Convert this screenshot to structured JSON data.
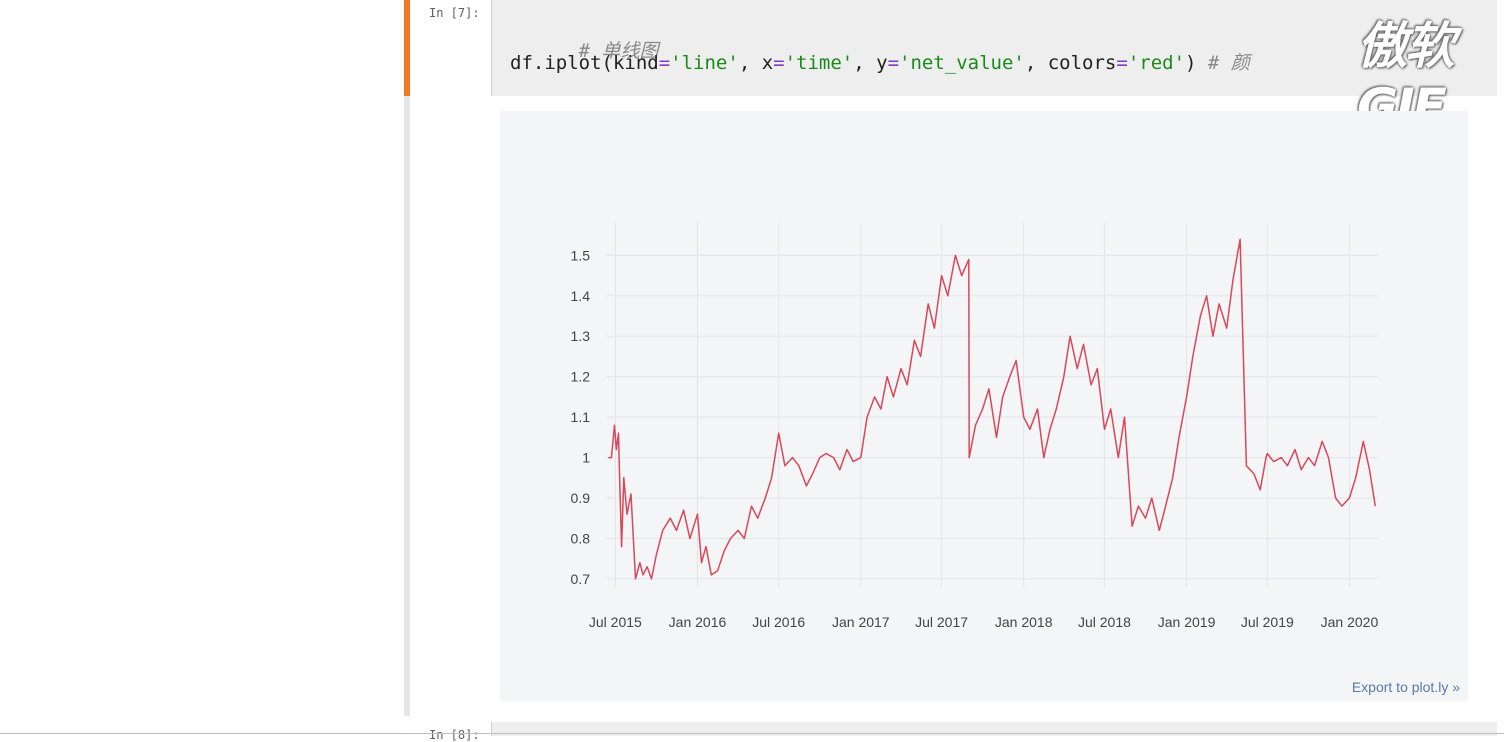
{
  "cell7": {
    "prompt": "In [7]:",
    "code": {
      "comment1": "# 单线图",
      "line2_parts": [
        "df.iplot(kind",
        "=",
        "'line'",
        ", x",
        "=",
        "'time'",
        ", y",
        "=",
        "'net_value'",
        ", colors",
        "=",
        "'red'",
        ") ",
        "# 颜"
      ]
    },
    "watermark": "傲软GIF",
    "export_link": "Export to plot.ly »"
  },
  "cell8": {
    "prompt": "In [8]:"
  },
  "colors": {
    "line": "#d9485a",
    "accent": "#f37726",
    "grid": "#e1e4ea",
    "plot_bg": "#f4f5f7"
  },
  "chart_data": {
    "type": "line",
    "x": [
      "2015-06-15",
      "2015-06-22",
      "2015-06-29",
      "2015-07-03",
      "2015-07-08",
      "2015-07-10",
      "2015-07-15",
      "2015-07-20",
      "2015-07-27",
      "2015-08-05",
      "2015-08-15",
      "2015-08-25",
      "2015-09-01",
      "2015-09-10",
      "2015-09-20",
      "2015-10-01",
      "2015-10-15",
      "2015-11-01",
      "2015-11-15",
      "2015-12-01",
      "2015-12-15",
      "2016-01-01",
      "2016-01-10",
      "2016-01-20",
      "2016-02-01",
      "2016-02-15",
      "2016-03-01",
      "2016-03-15",
      "2016-04-01",
      "2016-04-15",
      "2016-05-01",
      "2016-05-15",
      "2016-06-01",
      "2016-06-15",
      "2016-07-01",
      "2016-07-15",
      "2016-08-01",
      "2016-08-15",
      "2016-09-01",
      "2016-09-15",
      "2016-10-01",
      "2016-10-15",
      "2016-11-01",
      "2016-11-15",
      "2016-12-01",
      "2016-12-15",
      "2017-01-01",
      "2017-01-15",
      "2017-02-01",
      "2017-02-15",
      "2017-03-01",
      "2017-03-15",
      "2017-04-01",
      "2017-04-15",
      "2017-05-01",
      "2017-05-15",
      "2017-06-01",
      "2017-06-15",
      "2017-07-01",
      "2017-07-15",
      "2017-08-01",
      "2017-08-15",
      "2017-08-31",
      "2017-09-01",
      "2017-09-15",
      "2017-10-01",
      "2017-10-15",
      "2017-11-01",
      "2017-11-15",
      "2017-12-01",
      "2017-12-15",
      "2018-01-01",
      "2018-01-15",
      "2018-02-01",
      "2018-02-15",
      "2018-03-01",
      "2018-03-15",
      "2018-04-01",
      "2018-04-15",
      "2018-05-01",
      "2018-05-15",
      "2018-06-01",
      "2018-06-15",
      "2018-07-01",
      "2018-07-15",
      "2018-08-01",
      "2018-08-15",
      "2018-09-01",
      "2018-09-15",
      "2018-10-01",
      "2018-10-15",
      "2018-11-01",
      "2018-11-15",
      "2018-12-01",
      "2018-12-15",
      "2019-01-01",
      "2019-01-15",
      "2019-02-01",
      "2019-02-15",
      "2019-03-01",
      "2019-03-15",
      "2019-04-01",
      "2019-04-15",
      "2019-05-01",
      "2019-05-15",
      "2019-06-01",
      "2019-06-15",
      "2019-06-28",
      "2019-07-01",
      "2019-07-15",
      "2019-08-01",
      "2019-08-15",
      "2019-09-01",
      "2019-09-15",
      "2019-10-01",
      "2019-10-15",
      "2019-11-01",
      "2019-11-15",
      "2019-12-01",
      "2019-12-15",
      "2020-01-01",
      "2020-01-15",
      "2020-02-01",
      "2020-02-15",
      "2020-02-28"
    ],
    "y": [
      1.0,
      1.0,
      1.08,
      1.02,
      1.06,
      0.97,
      0.78,
      0.95,
      0.86,
      0.91,
      0.7,
      0.74,
      0.71,
      0.73,
      0.7,
      0.76,
      0.82,
      0.85,
      0.82,
      0.87,
      0.8,
      0.86,
      0.74,
      0.78,
      0.71,
      0.72,
      0.77,
      0.8,
      0.82,
      0.8,
      0.88,
      0.85,
      0.9,
      0.95,
      1.06,
      0.98,
      1.0,
      0.98,
      0.93,
      0.96,
      1.0,
      1.01,
      1.0,
      0.97,
      1.02,
      0.99,
      1.0,
      1.1,
      1.15,
      1.12,
      1.2,
      1.15,
      1.22,
      1.18,
      1.29,
      1.25,
      1.38,
      1.32,
      1.45,
      1.4,
      1.5,
      1.45,
      1.49,
      1.0,
      1.08,
      1.12,
      1.17,
      1.05,
      1.15,
      1.2,
      1.24,
      1.1,
      1.07,
      1.12,
      1.0,
      1.07,
      1.12,
      1.2,
      1.3,
      1.22,
      1.28,
      1.18,
      1.22,
      1.07,
      1.12,
      1.0,
      1.1,
      0.83,
      0.88,
      0.85,
      0.9,
      0.82,
      0.88,
      0.95,
      1.05,
      1.15,
      1.25,
      1.35,
      1.4,
      1.3,
      1.38,
      1.32,
      1.44,
      1.54,
      0.98,
      0.96,
      0.92,
      1.0,
      1.01,
      0.99,
      1.0,
      0.98,
      1.02,
      0.97,
      1.0,
      0.98,
      1.04,
      1.0,
      0.9,
      0.88,
      0.9,
      0.95,
      1.04,
      0.97,
      0.88
    ],
    "ylim": [
      0.68,
      1.58
    ],
    "yticks": [
      0.7,
      0.8,
      0.9,
      1,
      1.1,
      1.2,
      1.3,
      1.4,
      1.5
    ],
    "ytick_labels": [
      "0.7",
      "0.8",
      "0.9",
      "1",
      "1.1",
      "1.2",
      "1.3",
      "1.4",
      "1.5"
    ],
    "xticks": [
      "2015-07-01",
      "2016-01-01",
      "2016-07-01",
      "2017-01-01",
      "2017-07-01",
      "2018-01-01",
      "2018-07-01",
      "2019-01-01",
      "2019-07-01",
      "2020-01-01"
    ],
    "xtick_labels": [
      "Jul 2015",
      "Jan 2016",
      "Jul 2016",
      "Jan 2017",
      "Jul 2017",
      "Jan 2018",
      "Jul 2018",
      "Jan 2019",
      "Jul 2019",
      "Jan 2020"
    ],
    "xlim": [
      "2015-06-10",
      "2020-03-05"
    ],
    "grid": true,
    "legend": "none"
  }
}
